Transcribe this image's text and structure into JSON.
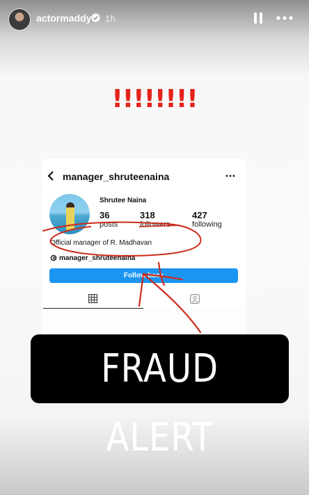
{
  "story_header": {
    "username": "actormaddy",
    "time": "1h",
    "verified": true
  },
  "exclamation": "!!!!!!!!",
  "screenshot": {
    "handle": "manager_shruteenaina",
    "profile_name": "Shrutee Naina",
    "stats": [
      {
        "value": "36",
        "label": "posts"
      },
      {
        "value": "318",
        "label": "followers"
      },
      {
        "value": "427",
        "label": "following"
      }
    ],
    "bio": "Official manager of R. Madhavan",
    "threads_handle": "manager_shruteenaina",
    "follow_button": "Follow back"
  },
  "alert_text": "FRAUD ALERT",
  "colors": {
    "alert_red": "#e4231b",
    "follow_blue": "#1b95f2",
    "annotation_red": "#cc2a1a"
  },
  "icons": [
    "avatar",
    "verified-badge-icon",
    "pause-icon",
    "more-icon",
    "back-arrow-icon",
    "more-dots-icon",
    "threads-icon",
    "grid-icon",
    "tagged-icon"
  ]
}
